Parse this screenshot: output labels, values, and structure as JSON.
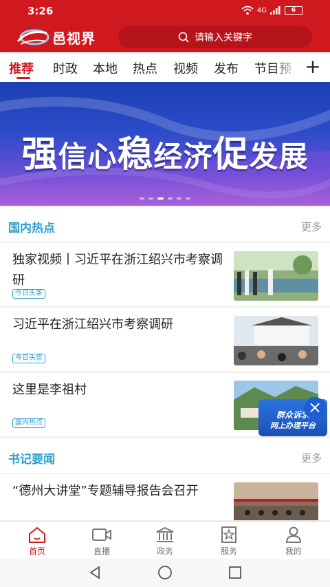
{
  "status": {
    "time": "3:26",
    "network": "4G",
    "battery": "6"
  },
  "header": {
    "logo_text": "邑视界",
    "search_placeholder": "请输入关键字"
  },
  "tabs": [
    {
      "label": "推荐"
    },
    {
      "label": "时政"
    },
    {
      "label": "本地"
    },
    {
      "label": "热点"
    },
    {
      "label": "视频"
    },
    {
      "label": "发布"
    },
    {
      "label": "节目预"
    }
  ],
  "banner": {
    "text_a": "强",
    "text_b": "信心",
    "text_c": "稳",
    "text_d": "经济",
    "text_e": "促",
    "text_f": "发展",
    "page_count": 6,
    "current_page": 3
  },
  "sections": {
    "domestic": {
      "title": "国内热点",
      "more": "更多"
    },
    "secretary": {
      "title": "书记要闻",
      "more": "更多"
    }
  },
  "news": [
    {
      "title": "独家视频丨习近平在浙江绍兴市考察调研",
      "tag": "今日头条"
    },
    {
      "title": "习近平在浙江绍兴市考察调研",
      "tag": "今日头条"
    },
    {
      "title": "这里是李祖村",
      "tag": "国内热点"
    },
    {
      "title": "“德州大讲堂”专题辅导报告会召开"
    }
  ],
  "float_badge": {
    "line1": "群众诉求",
    "line2": "网上办理平台"
  },
  "bottom_nav": [
    {
      "label": "首页"
    },
    {
      "label": "直播"
    },
    {
      "label": "政务"
    },
    {
      "label": "服务"
    },
    {
      "label": "我的"
    }
  ],
  "colors": {
    "brand": "#d0191f",
    "section_accent": "#2e9fce"
  }
}
